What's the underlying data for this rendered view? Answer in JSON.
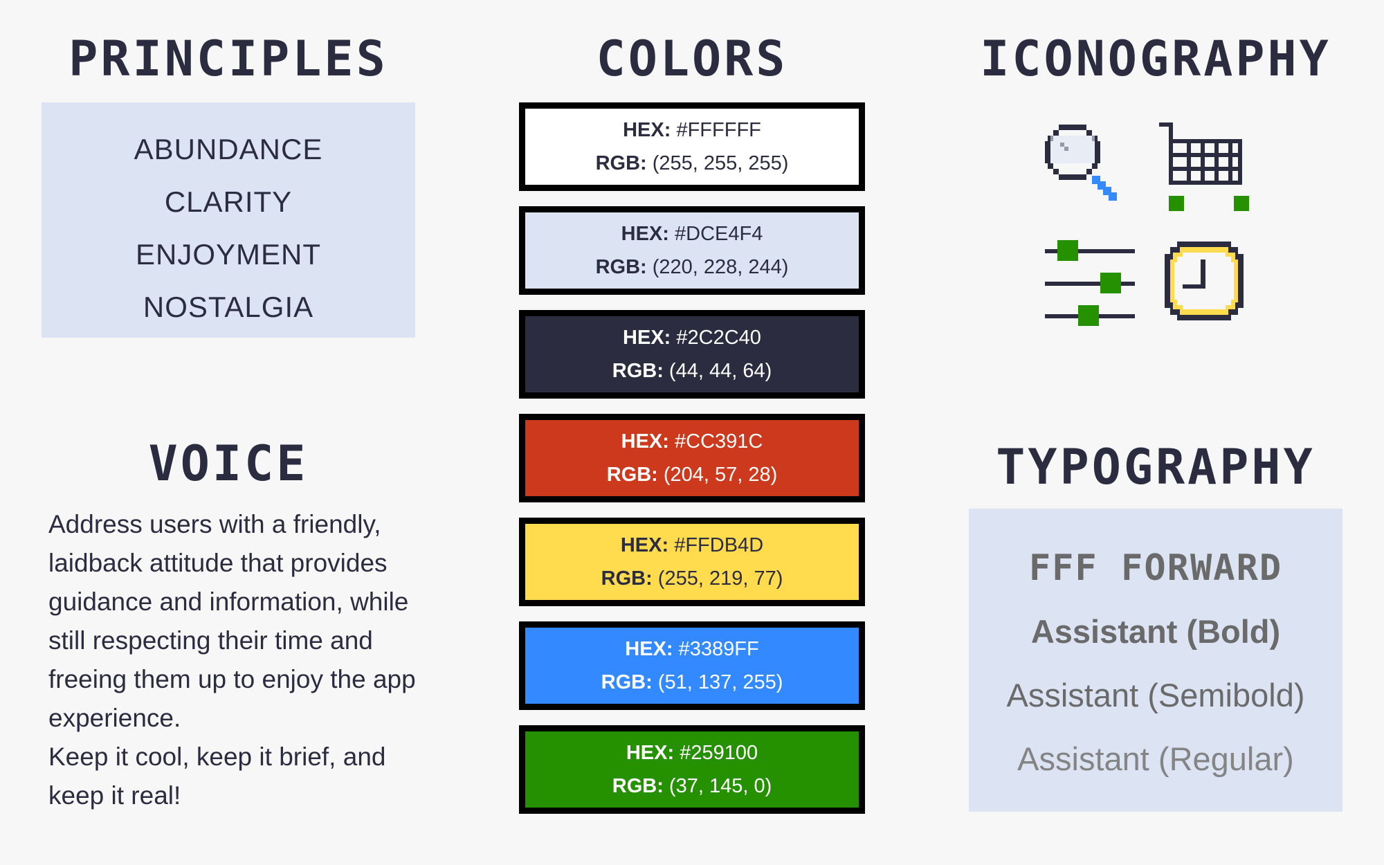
{
  "principles": {
    "title": "PRINCIPLES",
    "items": [
      "ABUNDANCE",
      "CLARITY",
      "ENJOYMENT",
      "NOSTALGIA"
    ]
  },
  "voice": {
    "title": "VOICE",
    "paragraphs": [
      "Address users with a friendly, laidback attitude that provides guidance and information, while still respecting their time and freeing them up to enjoy the app experience.",
      "Keep it cool, keep it brief, and keep it real!"
    ]
  },
  "colors": {
    "title": "COLORS",
    "hex_label": "HEX:",
    "rgb_label": "RGB:",
    "swatches": [
      {
        "hex": "#FFFFFF",
        "rgb": "(255, 255, 255)",
        "fill": "#ffffff",
        "text": "#2c2c40"
      },
      {
        "hex": "#DCE4F4",
        "rgb": "(220, 228, 244)",
        "fill": "#dce4f4",
        "text": "#2c2c40"
      },
      {
        "hex": "#2C2C40",
        "rgb": "(44, 44, 64)",
        "fill": "#2c2c40",
        "text": "#ffffff"
      },
      {
        "hex": "#CC391C",
        "rgb": "(204, 57, 28)",
        "fill": "#cc391c",
        "text": "#ffffff"
      },
      {
        "hex": "#FFDB4D",
        "rgb": "(255, 219, 77)",
        "fill": "#ffdb4d",
        "text": "#2c2c40"
      },
      {
        "hex": "#3389FF",
        "rgb": "(51, 137, 255)",
        "fill": "#3389ff",
        "text": "#ffffff"
      },
      {
        "hex": "#259100",
        "rgb": "(37, 145, 0)",
        "fill": "#259100",
        "text": "#ffffff"
      }
    ]
  },
  "iconography": {
    "title": "ICONOGRAPHY",
    "icons": [
      "search-icon",
      "cart-icon",
      "sliders-icon",
      "clock-icon"
    ]
  },
  "typography": {
    "title": "TYPOGRAPHY",
    "samples": [
      "FFF FORWARD",
      "Assistant (Bold)",
      "Assistant (Semibold)",
      "Assistant (Regular)"
    ]
  }
}
